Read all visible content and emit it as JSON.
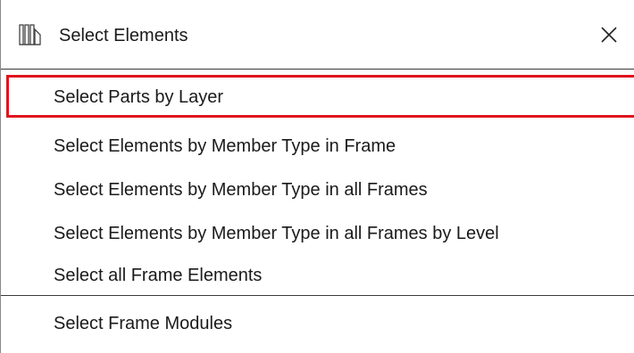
{
  "window": {
    "title": "Select Elements",
    "icon": "frame-columns-icon",
    "close_icon": "close-icon"
  },
  "menu": {
    "items": [
      {
        "label": "Select Parts by Layer",
        "highlighted": true
      },
      {
        "label": "Select Elements by Member Type in Frame"
      },
      {
        "label": "Select Elements by Member Type in all Frames"
      },
      {
        "label": "Select Elements by Member Type in all Frames by Level"
      },
      {
        "label": "Select all Frame Elements"
      },
      {
        "label": "Select Frame Modules"
      }
    ]
  },
  "colors": {
    "highlight_border": "#e0141e",
    "separator": "#3a3a3a",
    "text": "#1a1a1a"
  }
}
